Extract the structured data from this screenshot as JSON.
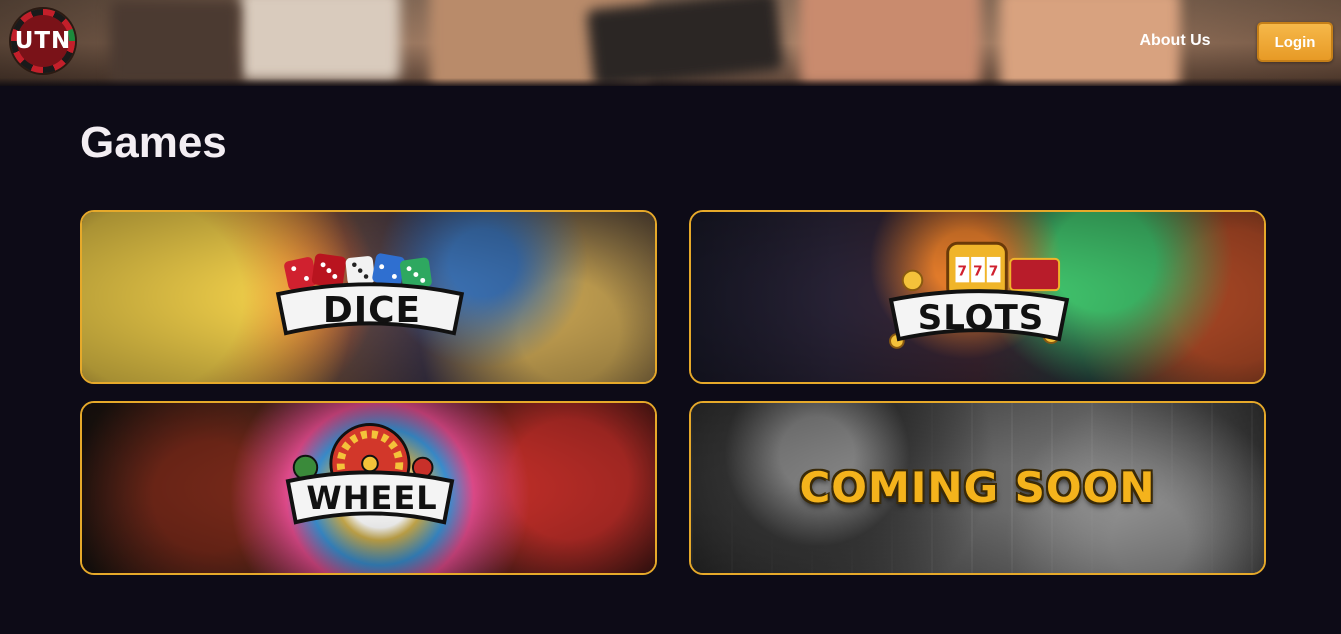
{
  "header": {
    "logo_text": "UTN",
    "nav": {
      "about_label": "About Us"
    },
    "login_label": "Login"
  },
  "main": {
    "title": "Games",
    "cards": [
      {
        "id": "dice",
        "logo_text": "DICE"
      },
      {
        "id": "slots",
        "logo_text": "SLOTS"
      },
      {
        "id": "wheel",
        "logo_text": "WHEEL"
      },
      {
        "id": "coming-soon",
        "logo_text": "COMING SOON"
      }
    ]
  },
  "colors": {
    "page_background": "#0d0b17",
    "card_border": "#e6a92a",
    "login_button": "#f0a83a",
    "coming_soon_text": "#f4b31c"
  }
}
